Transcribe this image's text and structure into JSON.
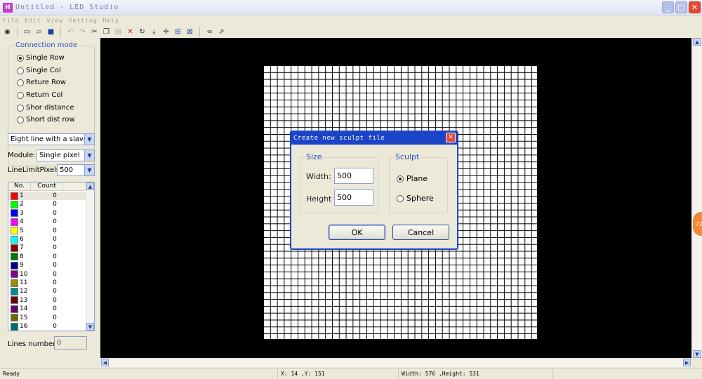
{
  "window": {
    "title": "Untitled - LED Studio"
  },
  "menu": [
    "File",
    "Edit",
    "View",
    "Setting",
    "Help"
  ],
  "toolbar": {
    "icons": [
      "record-icon",
      "new-file-icon",
      "open-file-icon",
      "save-icon",
      "undo-icon",
      "redo-icon",
      "cut-icon",
      "copy-icon",
      "paste-icon",
      "delete-icon",
      "rotate-icon",
      "download-icon",
      "crosshair-icon",
      "grid-icon",
      "box-icon",
      "binoculars-icon",
      "export-icon"
    ]
  },
  "connection": {
    "legend": "Connection mode",
    "options": [
      "Single Row",
      "Single Col",
      "Reture Row",
      "Return Col",
      "Shor distance",
      "Short dist row"
    ],
    "selected_index": 0
  },
  "slave_select": {
    "value": "Eight line with a slave"
  },
  "module": {
    "label": "Module:",
    "value": "Single pixel"
  },
  "line_limit": {
    "label": "LineLimitPixels:",
    "value": "500"
  },
  "port_list": {
    "headers": [
      "No.",
      "Count"
    ],
    "rows": [
      {
        "no": "1",
        "count": "0",
        "color": "#ff0000"
      },
      {
        "no": "2",
        "count": "0",
        "color": "#00ff00"
      },
      {
        "no": "3",
        "count": "0",
        "color": "#0000ff"
      },
      {
        "no": "4",
        "count": "0",
        "color": "#ff00ff"
      },
      {
        "no": "5",
        "count": "0",
        "color": "#ffff00"
      },
      {
        "no": "6",
        "count": "0",
        "color": "#00ffff"
      },
      {
        "no": "7",
        "count": "0",
        "color": "#8b0000"
      },
      {
        "no": "8",
        "count": "0",
        "color": "#007a00"
      },
      {
        "no": "9",
        "count": "0",
        "color": "#00008b"
      },
      {
        "no": "10",
        "count": "0",
        "color": "#8b008b"
      },
      {
        "no": "11",
        "count": "0",
        "color": "#a08a00"
      },
      {
        "no": "12",
        "count": "0",
        "color": "#008b8b"
      },
      {
        "no": "13",
        "count": "0",
        "color": "#6b0000"
      },
      {
        "no": "14",
        "count": "0",
        "color": "#6b006b"
      },
      {
        "no": "15",
        "count": "0",
        "color": "#6b6b00"
      },
      {
        "no": "16",
        "count": "0",
        "color": "#006b6b"
      }
    ]
  },
  "lines_number": {
    "label": "Lines number:",
    "value": "0"
  },
  "badge": {
    "text": "72"
  },
  "status": {
    "state": "Ready",
    "coords": "X: 14 ,Y: 151",
    "size": "Width: 576 ,Height: 531"
  },
  "dialog": {
    "title": "Create new sculpt file",
    "size_legend": "Size",
    "width_label": "Width:",
    "width_value": "500",
    "height_label": "Height",
    "height_value": "500",
    "sculpt_legend": "Sculpt",
    "plane_label": "Plane",
    "sphere_label": "Sphere",
    "ok_label": "OK",
    "cancel_label": "Cancel"
  }
}
